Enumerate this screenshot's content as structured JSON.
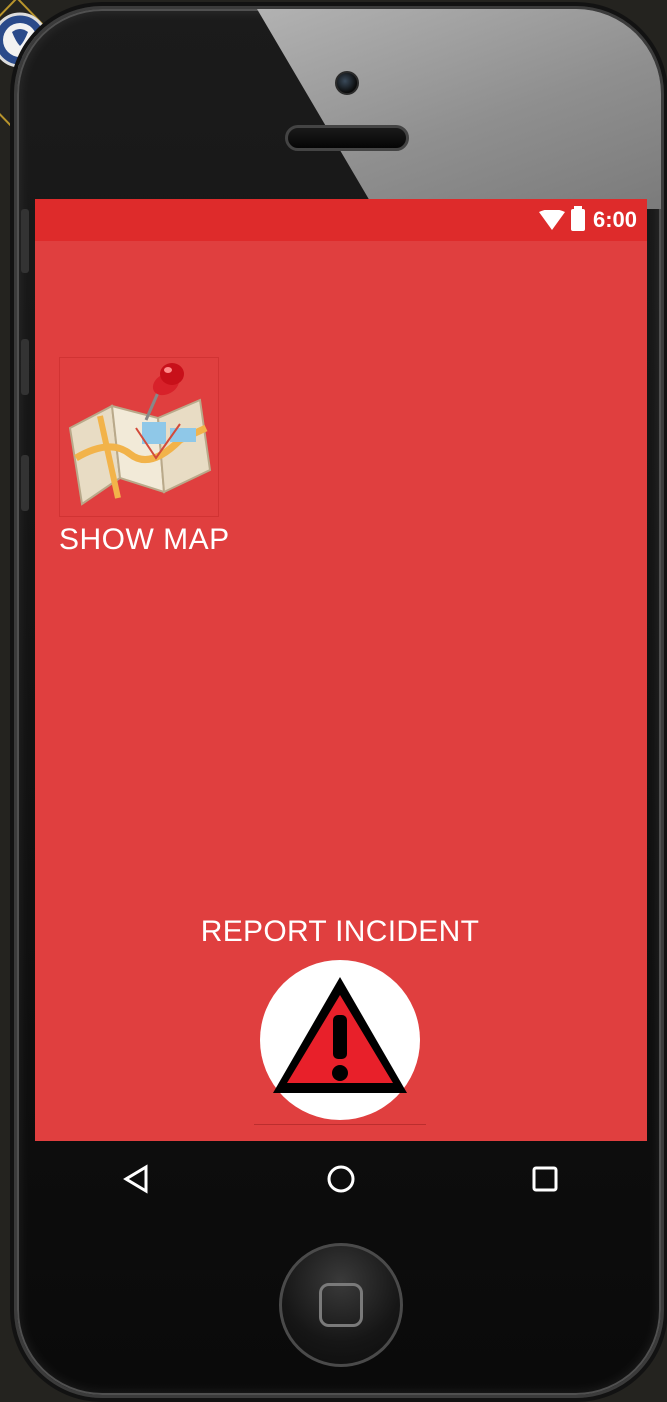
{
  "status_bar": {
    "time": "6:00",
    "icons": [
      "wifi-icon",
      "battery-icon"
    ]
  },
  "main": {
    "show_map_label": "SHOW MAP",
    "show_map_icon": "map-pin-icon",
    "report_label": "REPORT INCIDENT",
    "report_icon": "warning-icon"
  },
  "nav": {
    "items": [
      "back-icon",
      "home-icon",
      "recents-icon"
    ]
  },
  "colors": {
    "screen_bg": "#e03f3f",
    "status_bar_bg": "#de2b2b",
    "text": "#ffffff",
    "warning_fill": "#e8202a"
  }
}
